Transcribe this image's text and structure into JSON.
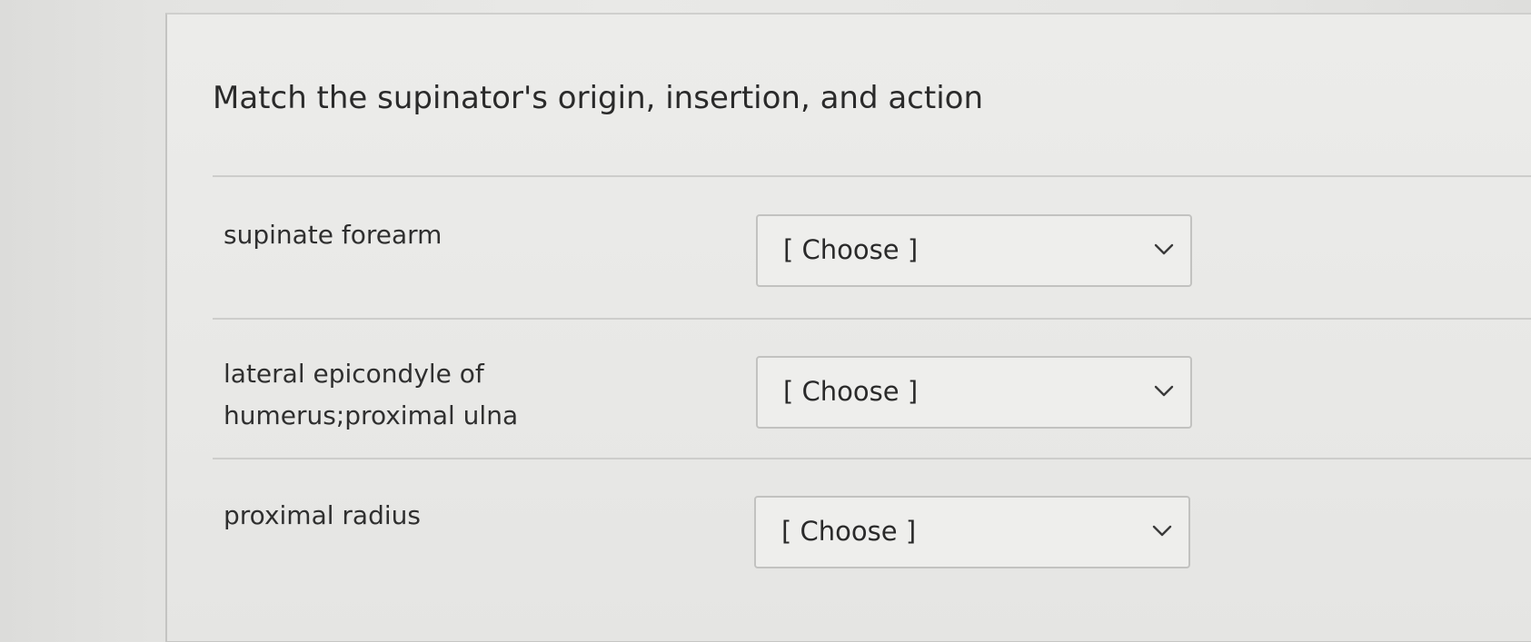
{
  "question": {
    "title": "Match the supinator's origin, insertion, and action"
  },
  "rows": [
    {
      "label": "supinate forearm",
      "select_value": "[ Choose ]"
    },
    {
      "label": "lateral epicondyle of humerus;proximal ulna",
      "select_value": "[ Choose ]"
    },
    {
      "label": "proximal radius",
      "select_value": "[ Choose ]"
    }
  ],
  "icons": {
    "dropdown": "chevron-down-icon"
  }
}
